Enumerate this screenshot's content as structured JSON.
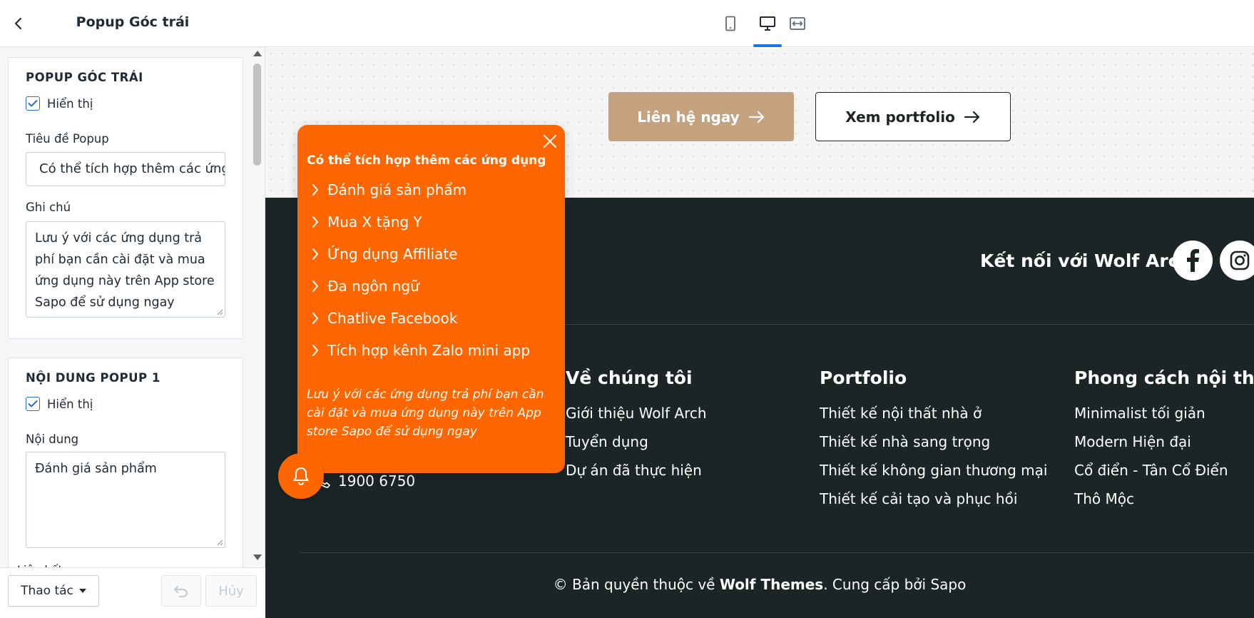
{
  "panel": {
    "title": "Popup Góc trái",
    "card1": {
      "heading": "POPUP GÓC TRÁI",
      "show_label": "Hiển thị",
      "popup_title_label": "Tiêu đề Popup",
      "popup_title_value": "Có thể tích hợp thêm các ứng dụng",
      "note_label": "Ghi chú",
      "note_value": "Lưu ý với các ứng dụng trả phí bạn cần cài đặt và mua ứng dụng này trên App store Sapo để sử dụng ngay"
    },
    "card2": {
      "heading": "NỘI DUNG POPUP 1",
      "show_label": "Hiển thị",
      "content_label": "Nội dung",
      "content_value": "Đánh giá sản phẩm",
      "cut_label": "Liên kết"
    },
    "footer": {
      "actions_label": "Thao tác",
      "cancel_label": "Hủy"
    }
  },
  "preview": {
    "hero": {
      "contact_label": "Liên hệ ngay",
      "portfolio_label": "Xem portfolio"
    },
    "footer": {
      "connect_label": "Kết nối với Wolf Arch",
      "phone": "1900 6750",
      "columns": [
        {
          "title": "Về chúng tôi",
          "links": [
            "Giới thiệu Wolf Arch",
            "Tuyển dụng",
            "Dự án đã thực hiện"
          ]
        },
        {
          "title": "Portfolio",
          "links": [
            "Thiết kế nội thất nhà ở",
            "Thiết kế nhà sang trọng",
            "Thiết kế không gian thương mại",
            "Thiết kế cải tạo và phục hồi"
          ]
        },
        {
          "title": "Phong cách nội thất",
          "links": [
            "Minimalist tối giản",
            "Modern Hiện đại",
            "Cổ điển - Tân Cổ Điển",
            "Thô Mộc"
          ]
        }
      ],
      "copyright_prefix": "© Bản quyền thuộc về ",
      "copyright_brand": "Wolf Themes",
      "copyright_suffix": ". Cung cấp bởi Sapo"
    },
    "popup": {
      "title": "Có thể tích hợp thêm các ứng dụng",
      "items": [
        "Đánh giá sản phẩm",
        "Mua X tặng Y",
        "Ứng dụng Affiliate",
        "Đa ngôn ngữ",
        "Chatlive Facebook",
        "Tích hợp kênh Zalo mini app"
      ],
      "note": "Lưu ý với các ứng dụng trả phí bạn cần cài đặt và mua ứng dụng này trên App store Sapo để sử dụng ngay"
    }
  },
  "colors": {
    "popup_orange": "#ff6600",
    "footer_dark": "#1b2526",
    "contact_tan": "#c4a27f",
    "accent_blue": "#1a73e8"
  },
  "icons": [
    "chevron-left-icon",
    "mobile-icon",
    "desktop-icon",
    "fullwidth-icon",
    "arrow-right-icon",
    "facebook-icon",
    "instagram-icon",
    "close-icon",
    "chevron-right-icon",
    "bell-icon",
    "phone-icon",
    "undo-icon",
    "checkmark-icon",
    "caret-down-icon"
  ]
}
